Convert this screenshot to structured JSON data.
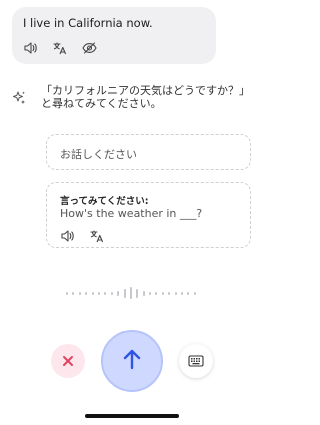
{
  "user_message": {
    "text": "I live in California now.",
    "icons": [
      "speaker-icon",
      "translate-icon",
      "eye-slash-icon"
    ]
  },
  "ai_message": {
    "icon": "sparkle-icon",
    "text": "「カリフォルニアの天気はどうですか？」と尋ねてみてください。"
  },
  "speak_card": {
    "label": "お話しください"
  },
  "say_card": {
    "title": "言ってみてください:",
    "sentence": "How's the weather in ___?",
    "icons": [
      "speaker-icon",
      "translate-icon"
    ]
  },
  "controls": {
    "cancel_icon": "close-icon",
    "send_icon": "arrow-up-icon",
    "keyboard_icon": "keyboard-icon"
  },
  "colors": {
    "cancel_bg": "#fde7ec",
    "cancel_icon": "#e0445e",
    "send_bg": "#cfd9ff",
    "send_icon": "#2f55e4"
  }
}
